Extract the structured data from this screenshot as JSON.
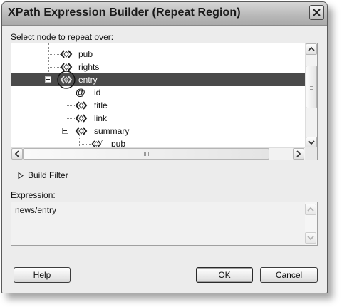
{
  "window": {
    "title": "XPath Expression Builder (Repeat Region)"
  },
  "tree": {
    "label": "Select node to repeat over:",
    "nodes": [
      {
        "label": "pub",
        "icon": "element-node-icon"
      },
      {
        "label": "rights",
        "icon": "element-node-icon"
      },
      {
        "label": "entry",
        "icon": "element-node-icon",
        "selected": true,
        "expanded": true
      },
      {
        "label": "id",
        "icon": "attribute-node-icon"
      },
      {
        "label": "title",
        "icon": "element-node-icon"
      },
      {
        "label": "link",
        "icon": "element-node-icon"
      },
      {
        "label": "summary",
        "icon": "element-node-icon",
        "expanded": true
      },
      {
        "label": "pub",
        "icon": "optional-element-node-icon"
      }
    ]
  },
  "filter": {
    "label": "Build Filter"
  },
  "expression": {
    "label": "Expression:",
    "value": "news/entry"
  },
  "buttons": {
    "help": "Help",
    "ok": "OK",
    "cancel": "Cancel"
  },
  "colors": {
    "selection": "#4a4a4a",
    "dialog_bg": "#ececec"
  }
}
